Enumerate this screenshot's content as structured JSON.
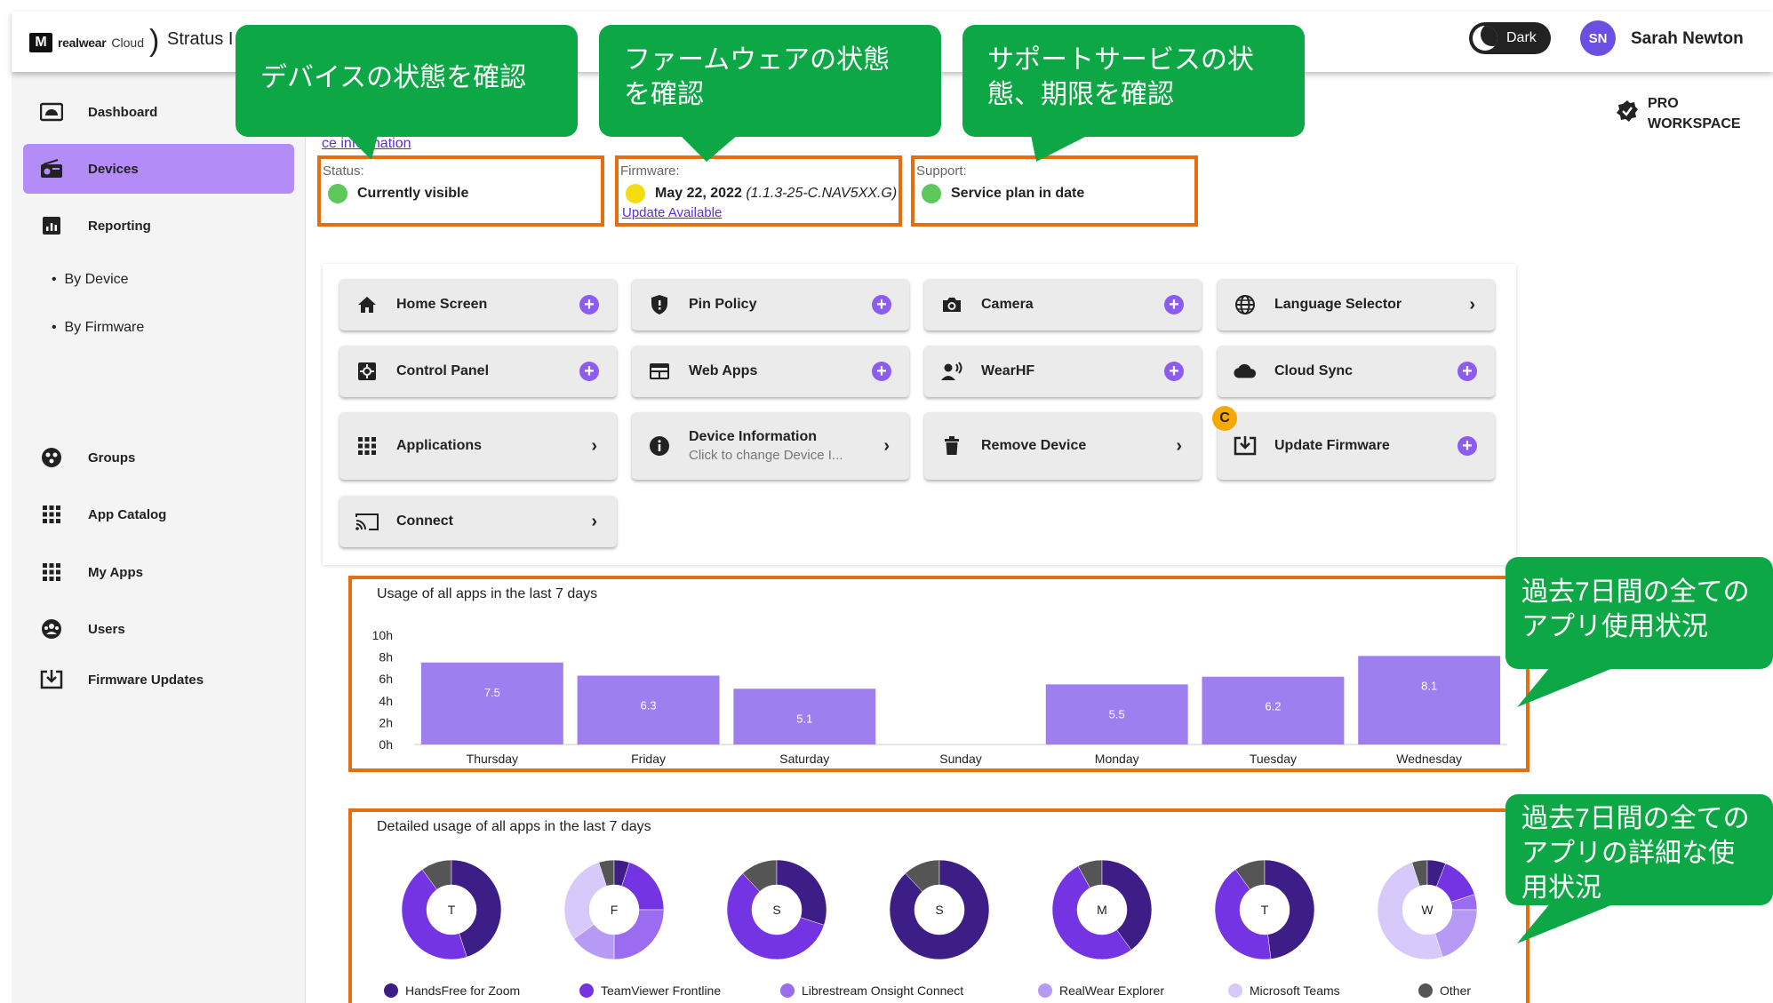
{
  "header": {
    "logo_mark": "M",
    "logo_brand": "realwear",
    "logo_cloud": "Cloud",
    "app_name": "Stratus I",
    "dark_label": "Dark",
    "user_initials": "SN",
    "user_name": "Sarah Newton"
  },
  "sidebar": {
    "items": [
      {
        "label": "Dashboard",
        "icon": "dashboard-icon"
      },
      {
        "label": "Devices",
        "icon": "radio-device-icon"
      },
      {
        "label": "Reporting",
        "icon": "chart-icon"
      },
      {
        "label": "By Device"
      },
      {
        "label": "By Firmware"
      },
      {
        "label": "Groups",
        "icon": "groups-icon"
      },
      {
        "label": "App Catalog",
        "icon": "apps-grid-icon"
      },
      {
        "label": "My Apps",
        "icon": "apps-grid-icon"
      },
      {
        "label": "Users",
        "icon": "users-icon"
      },
      {
        "label": "Firmware Updates",
        "icon": "download-icon"
      }
    ],
    "bullet": "•"
  },
  "workspace": {
    "line1": "PRO",
    "line2": "WORKSPACE"
  },
  "device_info_link": "ce information",
  "status": {
    "label": "Status:",
    "value": "Currently visible",
    "color": "#5cc85a"
  },
  "firmware": {
    "label": "Firmware:",
    "date": "May 22, 2022",
    "version": "(1.1.3-25-C.NAV5XX.G)",
    "link": "Update Available",
    "color": "#f3dd10"
  },
  "support": {
    "label": "Support:",
    "value": "Service plan in date",
    "color": "#5cc85a"
  },
  "tiles": [
    {
      "label": "Home Screen",
      "icon": "home-icon",
      "action": "plus"
    },
    {
      "label": "Pin Policy",
      "icon": "shield-icon",
      "action": "plus"
    },
    {
      "label": "Camera",
      "icon": "camera-icon",
      "action": "plus"
    },
    {
      "label": "Language Selector",
      "icon": "globe-icon",
      "action": "chevron"
    },
    {
      "label": "Control Panel",
      "icon": "control-panel-icon",
      "action": "plus"
    },
    {
      "label": "Web Apps",
      "icon": "web-apps-icon",
      "action": "plus"
    },
    {
      "label": "WearHF",
      "icon": "voice-icon",
      "action": "plus"
    },
    {
      "label": "Cloud Sync",
      "icon": "cloud-icon",
      "action": "plus"
    },
    {
      "label": "Applications",
      "icon": "apps-grid-icon",
      "action": "chevron"
    },
    {
      "label": "Device Information",
      "sub": "Click to change Device I...",
      "icon": "info-icon",
      "action": "chevron"
    },
    {
      "label": "Remove Device",
      "icon": "trash-icon",
      "action": "chevron"
    },
    {
      "label": "Update Firmware",
      "icon": "download-icon",
      "action": "plus"
    },
    {
      "label": "Connect",
      "icon": "cast-icon",
      "action": "chevron"
    }
  ],
  "update_badge": "C",
  "chart_data": [
    {
      "type": "bar",
      "title": "Usage of all apps in the last 7 days",
      "categories": [
        "Thursday",
        "Friday",
        "Saturday",
        "Sunday",
        "Monday",
        "Tuesday",
        "Wednesday"
      ],
      "values": [
        7.5,
        6.3,
        5.1,
        0,
        5.5,
        6.2,
        8.1
      ],
      "data_labels": [
        "7.5",
        "6.3",
        "5.1",
        "",
        "5.5",
        "6.2",
        "8.1"
      ],
      "yticks": [
        "0h",
        "2h",
        "4h",
        "6h",
        "8h",
        "10h"
      ],
      "ylim": [
        0,
        10
      ],
      "color": "#9d7ff0"
    },
    {
      "type": "pie",
      "title": "Detailed usage of all apps in the last 7 days",
      "labels": [
        "T",
        "F",
        "S",
        "S",
        "M",
        "T",
        "W"
      ],
      "series": [
        "HandsFree for Zoom",
        "TeamViewer Frontline",
        "Librestream Onsight Connect",
        "RealWear Explorer",
        "Microsoft Teams",
        "Other"
      ],
      "colors": [
        "#3d1d86",
        "#7434e4",
        "#9c6cf0",
        "#b79af3",
        "#d8c9fb",
        "#555555"
      ],
      "values": [
        [
          45,
          45,
          0,
          0,
          0,
          10
        ],
        [
          5,
          20,
          25,
          15,
          30,
          5
        ],
        [
          30,
          58,
          0,
          0,
          0,
          12
        ],
        [
          88,
          0,
          0,
          0,
          0,
          12
        ],
        [
          40,
          52,
          0,
          0,
          0,
          8
        ],
        [
          48,
          42,
          0,
          0,
          0,
          10
        ],
        [
          6,
          14,
          5,
          20,
          50,
          5
        ]
      ]
    }
  ],
  "callouts": [
    "デバイスの状態を確認",
    "ファームウェアの状態を確認",
    "サポートサービスの状態、期限を確認",
    "過去7日間の全てのアプリ使用状況",
    "過去7日間の全てのアプリの詳細な使用状況"
  ]
}
